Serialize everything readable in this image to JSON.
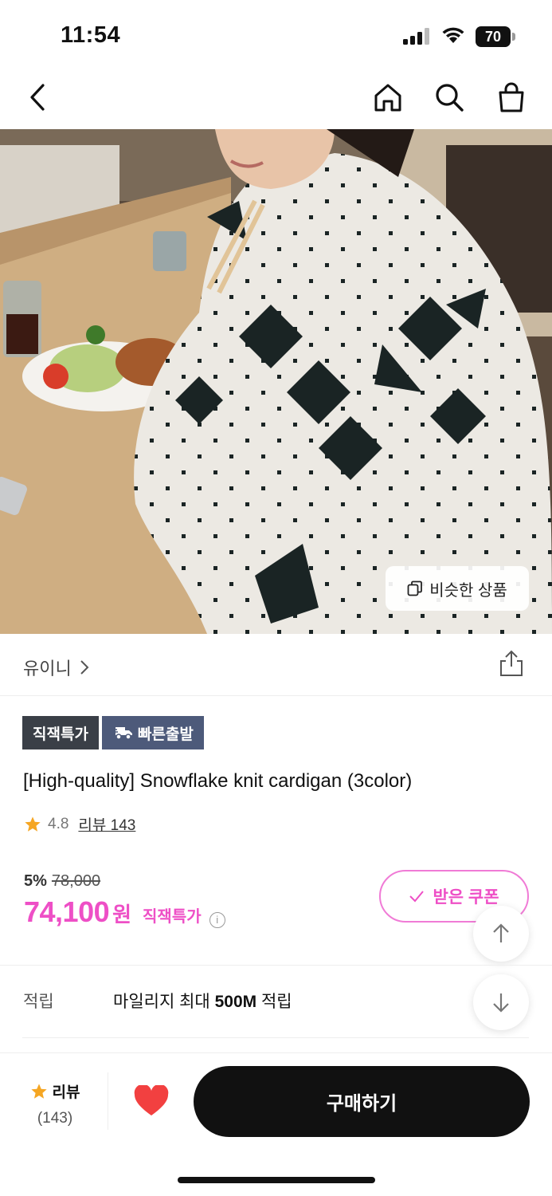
{
  "status_bar": {
    "time": "11:54",
    "battery": "70"
  },
  "nav": {
    "back": "back-icon",
    "home": "home-icon",
    "search": "search-icon",
    "cart": "shopping-bag-icon"
  },
  "hero": {
    "similar_button": "비슷한 상품"
  },
  "brand": {
    "name": "유이니"
  },
  "badges": [
    "직잭특가",
    "빠른출발"
  ],
  "product": {
    "title": "[High-quality] Snowflake knit cardigan (3color)",
    "rating": "4.8",
    "review_link": "리뷰 143"
  },
  "price": {
    "discount_pct": "5%",
    "original": "78,000",
    "final": "74,100",
    "currency": "원",
    "tag": "직잭특가",
    "info_icon": "i"
  },
  "coupon": {
    "label": "받은 쿠폰"
  },
  "mileage": {
    "label": "적립",
    "text_prefix": "마일리지 최대 ",
    "amount": "500M",
    "text_suffix": " 적립"
  },
  "bottom": {
    "review_label": "리뷰",
    "review_count": "(143)",
    "buy_label": "구매하기"
  },
  "colors": {
    "accent": "#ee4fc6",
    "dark": "#111111",
    "star": "#f5a623",
    "heart": "#f24040"
  }
}
